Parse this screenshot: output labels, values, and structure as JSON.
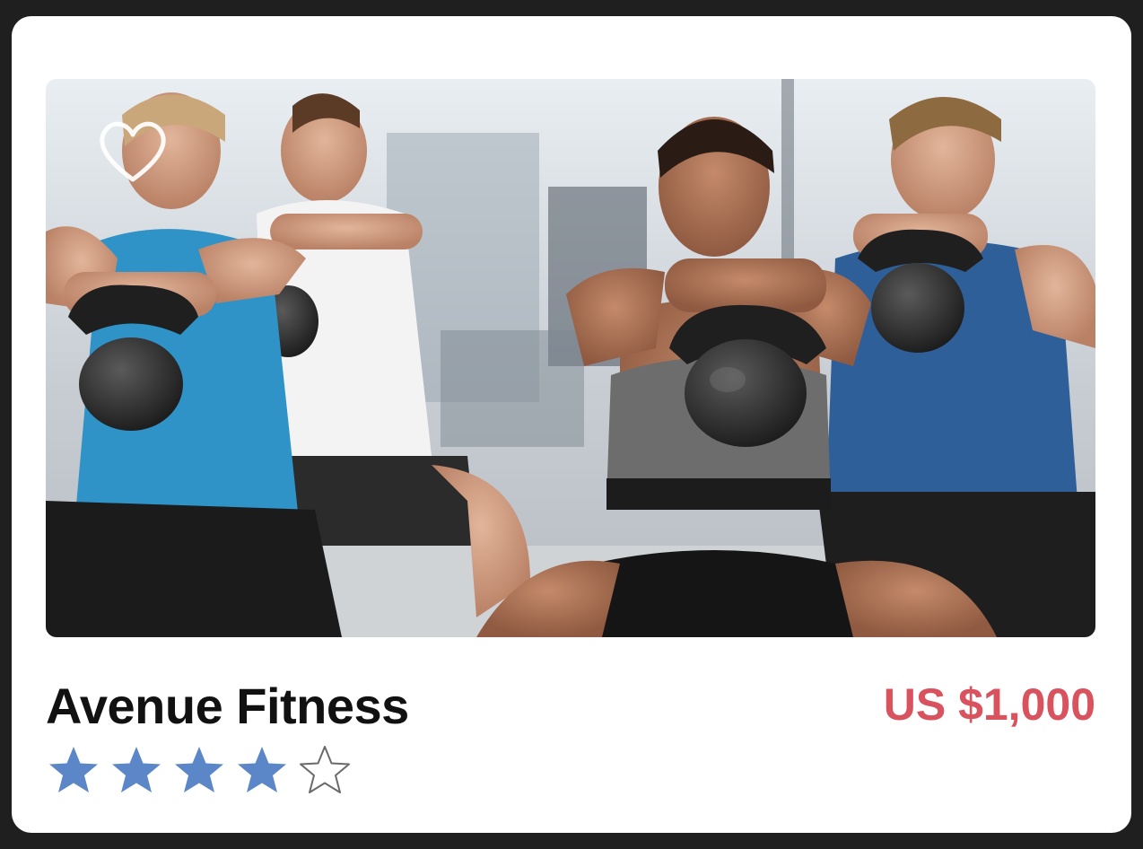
{
  "listing": {
    "name": "Avenue Fitness",
    "price": "US $1,000",
    "rating": 4,
    "rating_max": 5,
    "image_icon": "gym-photo",
    "favorite_icon": "heart-outline-icon"
  },
  "colors": {
    "price": "#d9535f",
    "star_filled": "#5b86c8",
    "star_empty_stroke": "#6a6a6a",
    "card_bg": "#ffffff",
    "page_bg": "#1f1f1f"
  }
}
